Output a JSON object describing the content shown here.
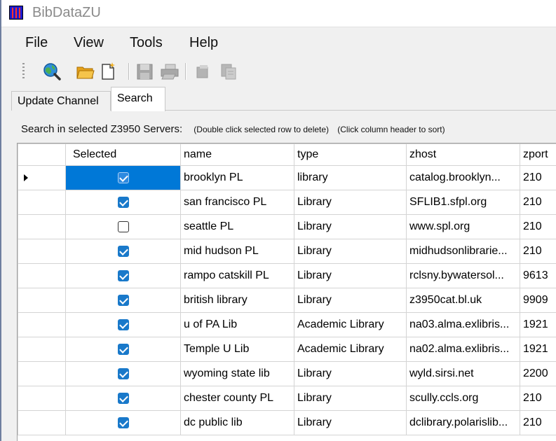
{
  "window": {
    "title": "BibDataZU"
  },
  "menu": [
    "File",
    "View",
    "Tools",
    "Help"
  ],
  "toolbar": {
    "buttons": [
      {
        "icon": "search-globe-icon",
        "enabled": true
      },
      {
        "icon": "open-folder-icon",
        "enabled": true
      },
      {
        "icon": "new-document-icon",
        "enabled": true
      },
      {
        "icon": "save-icon",
        "enabled": false
      },
      {
        "icon": "print-icon",
        "enabled": false
      },
      {
        "icon": "copy-icon",
        "enabled": false
      },
      {
        "icon": "paste-icon",
        "enabled": false
      }
    ]
  },
  "tabs": [
    {
      "label": "Update Channel",
      "active": false
    },
    {
      "label": "Search",
      "active": true
    }
  ],
  "search": {
    "instruction": "Search in selected Z3950 Servers:",
    "hint_delete": "(Double click selected row to delete)",
    "hint_sort": "(Click column header to sort)"
  },
  "grid": {
    "columns": [
      "Selected",
      "name",
      "type",
      "zhost",
      "zport"
    ],
    "rows": [
      {
        "selected": true,
        "name": "brooklyn PL",
        "type": "library",
        "zhost": "catalog.brooklyn...",
        "zport": "210",
        "current": true
      },
      {
        "selected": true,
        "name": "san francisco PL",
        "type": "Library",
        "zhost": "SFLIB1.sfpl.org",
        "zport": "210",
        "current": false
      },
      {
        "selected": false,
        "name": "seattle PL",
        "type": "Library",
        "zhost": "www.spl.org",
        "zport": "210",
        "current": false
      },
      {
        "selected": true,
        "name": "mid hudson PL",
        "type": "Library",
        "zhost": "midhudsonlibrarie...",
        "zport": "210",
        "current": false
      },
      {
        "selected": true,
        "name": "rampo catskill PL",
        "type": "Library",
        "zhost": "rclsny.bywatersol...",
        "zport": "9613",
        "current": false
      },
      {
        "selected": true,
        "name": "british library",
        "type": "Library",
        "zhost": "z3950cat.bl.uk",
        "zport": "9909",
        "current": false
      },
      {
        "selected": true,
        "name": "u of PA Lib",
        "type": "Academic Library",
        "zhost": "na03.alma.exlibris...",
        "zport": "1921",
        "current": false
      },
      {
        "selected": true,
        "name": "Temple U Lib",
        "type": "Academic Library",
        "zhost": "na02.alma.exlibris...",
        "zport": "1921",
        "current": false
      },
      {
        "selected": true,
        "name": "wyoming state lib",
        "type": "Library",
        "zhost": "wyld.sirsi.net",
        "zport": "2200",
        "current": false
      },
      {
        "selected": true,
        "name": "chester county PL",
        "type": "Library",
        "zhost": "scully.ccls.org",
        "zport": "210",
        "current": false
      },
      {
        "selected": true,
        "name": "dc public lib",
        "type": "Library",
        "zhost": "dclibrary.polarislib...",
        "zport": "210",
        "current": false
      }
    ]
  },
  "colors": {
    "accent": "#0078d7",
    "checkbox": "#1979ca"
  }
}
